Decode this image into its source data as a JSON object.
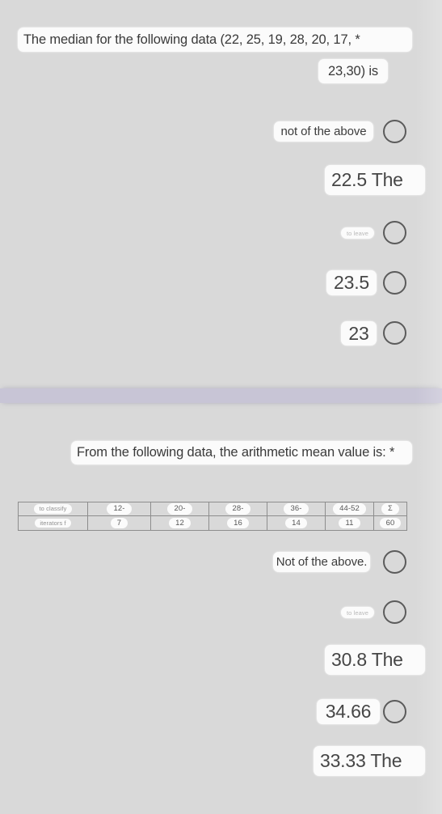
{
  "theme": {
    "page_background": "#d9d9d9",
    "chip_background": "#fbfbfb",
    "divider_band": "#c8c5d6",
    "radio_outline": "#5b5b5b",
    "table_border": "#8d8d8d",
    "text_primary": "#3c3c3c",
    "text_muted": "#909090"
  },
  "questions": [
    {
      "id": "q1",
      "prompt_line1": "The median for the following data (22, 25, 19, 28, 20, 17, *",
      "prompt_line2": "23,30) is",
      "required_marker": "*",
      "options": [
        {
          "label": "not of the above",
          "size": "md",
          "clipped": false,
          "selected": false
        },
        {
          "label": "22.5 The",
          "size": "lg",
          "clipped": true,
          "selected": false
        },
        {
          "label": "to leave",
          "size": "xs",
          "clipped": false,
          "selected": false
        },
        {
          "label": "23.5",
          "size": "lg",
          "clipped": false,
          "selected": false
        },
        {
          "label": "23",
          "size": "lg",
          "clipped": false,
          "selected": false
        }
      ]
    },
    {
      "id": "q2",
      "prompt_line1": "From the following data, the arithmetic mean value is: *",
      "required_marker": "*",
      "table": {
        "row_labels": [
          "to classify",
          "iterators f"
        ],
        "headers": [
          "12-",
          "20-",
          "28-",
          "36-",
          "44-52",
          "Σ"
        ],
        "frequencies": [
          "7",
          "12",
          "16",
          "14",
          "11",
          "60"
        ]
      },
      "options": [
        {
          "label": "Not of the above.",
          "size": "md",
          "clipped": false,
          "selected": false
        },
        {
          "label": "to leave",
          "size": "xs",
          "clipped": false,
          "selected": false
        },
        {
          "label": "30.8 The",
          "size": "lg",
          "clipped": true,
          "selected": false
        },
        {
          "label": "34.66",
          "size": "lg",
          "clipped": false,
          "selected": false
        },
        {
          "label": "33.33 The",
          "size": "lg",
          "clipped": true,
          "selected": false
        }
      ]
    }
  ],
  "chart_data": {
    "type": "table",
    "title": "From the following data, the arithmetic mean value is:",
    "categories": [
      "12-",
      "20-",
      "28-",
      "36-",
      "44-52"
    ],
    "values": [
      7,
      12,
      16,
      14,
      11
    ],
    "total": 60,
    "xlabel": "to classify",
    "ylabel": "iterators f"
  }
}
